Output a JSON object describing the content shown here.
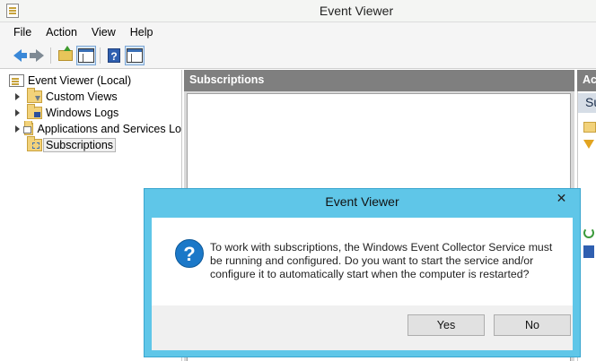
{
  "window": {
    "title": "Event Viewer"
  },
  "menu": [
    "File",
    "Action",
    "View",
    "Help"
  ],
  "toolbar": {
    "buttons": [
      "back-arrow-icon",
      "forward-arrow-icon",
      "up-one-level-icon",
      "show-hide-console-tree-icon",
      "help-icon",
      "show-hide-action-pane-icon"
    ]
  },
  "tree": {
    "root": "Event Viewer (Local)",
    "items": [
      {
        "label": "Custom Views",
        "icon": "custom-views-folder-icon"
      },
      {
        "label": "Windows Logs",
        "icon": "windows-logs-folder-icon"
      },
      {
        "label": "Applications and Services Lo",
        "icon": "app-services-folder-icon"
      },
      {
        "label": "Subscriptions",
        "icon": "subscriptions-folder-icon",
        "selected": true
      }
    ]
  },
  "main": {
    "header": "Subscriptions"
  },
  "actions": {
    "header": "Ac",
    "subheader": "Su"
  },
  "dialog": {
    "title": "Event Viewer",
    "close_label": "✕",
    "icon": "question-icon",
    "message": "To work with subscriptions, the Windows Event Collector Service must be running and configured.  Do you want to start the service and/or configure it to automatically start when the computer is restarted?",
    "yes_label": "Yes",
    "no_label": "No"
  },
  "colors": {
    "dialog_frame": "#5fc6e8",
    "pane_header": "#7f7f7f",
    "question_icon": "#1b78c8"
  }
}
